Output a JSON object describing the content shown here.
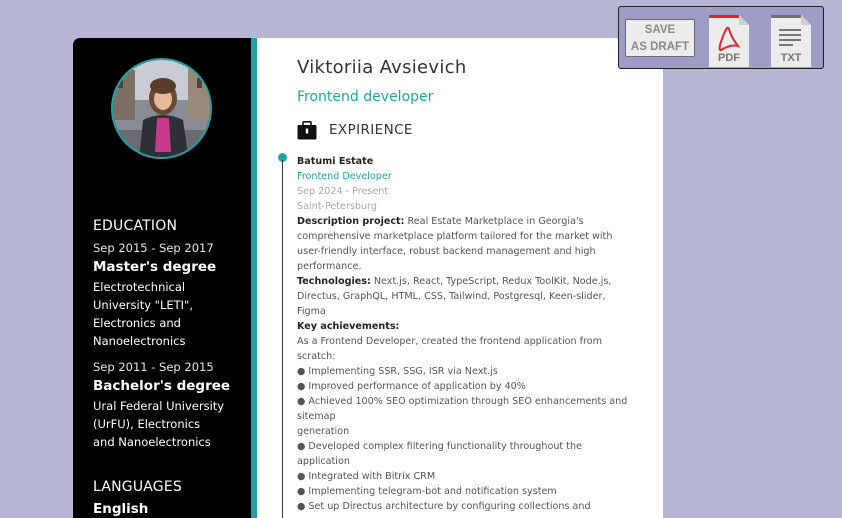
{
  "toolbar": {
    "draft_line1": "SAVE",
    "draft_line2": "AS DRAFT",
    "pdf_label": "PDF",
    "txt_label": "TXT"
  },
  "sidebar": {
    "avatar_icon": "profile-photo",
    "education": {
      "heading": "EDUCATION",
      "items": [
        {
          "dates": "Sep 2015 - Sep 2017",
          "degree": "Master's degree",
          "school": [
            "Electrotechnical",
            "University \"LETI\",",
            "Electronics and",
            "Nanoelectronics"
          ]
        },
        {
          "dates": "Sep 2011 - Sep 2015",
          "degree": "Bachelor's degree",
          "school": [
            "Ural Federal University",
            "(UrFU), Electronics",
            "and Nanoelectronics"
          ]
        }
      ]
    },
    "languages": {
      "heading": "LANGUAGES",
      "first": "English"
    }
  },
  "main": {
    "name": "Viktoriia Avsievich",
    "role": "Frontend developer",
    "experience_heading": "EXPIRIENCE",
    "experience_icon": "briefcase-icon",
    "job": {
      "company": "Batumi Estate",
      "position": "Frontend Developer",
      "dates": "Sep 2024 - Present",
      "location": "Saint-Petersburg",
      "desc_label": "Description project:",
      "desc_lines": [
        " Real Estate Marketplace in Georgia's",
        "comprehensive marketplace platform tailored for the market with",
        "user-friendly interface, robust backend management and high",
        "performance."
      ],
      "tech_label": "Technologies:",
      "tech_lines": [
        " Next.js, React, TypeScript, Redux ToolKit, Node.js,",
        "Directus, GraphQL, HTML, CSS, Tailwind, Postgresql, Keen-slider,",
        "Figma"
      ],
      "achievements_label": "Key achievements:",
      "achievement_lines": [
        "As a Frontend Developer, created the frontend application from",
        "scratch:",
        "● Implementing SSR, SSG, ISR via Next.js",
        "● Improved performance of application by 40%",
        "● Achieved 100% SEO optimization through SEO enhancements and",
        "sitemap",
        "generation",
        "● Developed complex filtering functionality throughout the",
        "application",
        "● Integrated with Bitrix CRM",
        "● Implementing telegram-bot and notification system",
        "● Set up Directus architecture by configuring collections and"
      ]
    }
  },
  "colors": {
    "accent": "#21a3a3",
    "sidebar": "#000000",
    "background": "#b7b7d5",
    "toolbar": "#9c9cc6",
    "pdf_red": "#e0262f"
  }
}
